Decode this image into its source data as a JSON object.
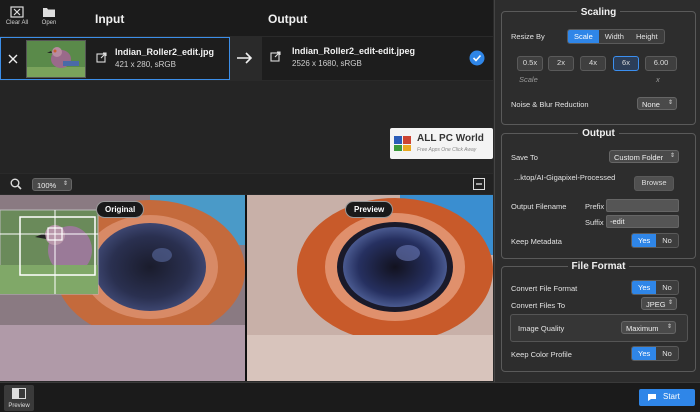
{
  "toolbar": {
    "clear_all": "Clear All",
    "open": "Open"
  },
  "headers": {
    "input": "Input",
    "output": "Output"
  },
  "input_file": {
    "name": "Indian_Roller2_edit.jpg",
    "meta": "421 x 280, sRGB"
  },
  "output_file": {
    "name": "Indian_Roller2_edit-edit.jpeg",
    "meta": "2526 x 1680, sRGB"
  },
  "watermark": {
    "title": "ALL PC World",
    "subtitle": "Free Apps One Click Away"
  },
  "zoom": {
    "value": "100%"
  },
  "preview": {
    "original_label": "Original",
    "preview_label": "Preview"
  },
  "bottom": {
    "preview_label": "Preview",
    "start_label": "Start"
  },
  "scaling": {
    "title": "Scaling",
    "resize_by_label": "Resize By",
    "resize_options": [
      "Scale",
      "Width",
      "Height"
    ],
    "scale_options": [
      "0.5x",
      "2x",
      "4x",
      "6x",
      "6.00"
    ],
    "scale_caption": "Scale",
    "scale_custom_caption": "x",
    "noise_label": "Noise & Blur Reduction",
    "noise_value": "None"
  },
  "output": {
    "title": "Output",
    "save_to_label": "Save To",
    "save_to_value": "Custom Folder",
    "path": "...ktop/AI-Gigapixel-Processed",
    "browse": "Browse",
    "filename_label": "Output Filename",
    "prefix_label": "Prefix",
    "suffix_label": "Suffix",
    "suffix_value": "-edit",
    "metadata_label": "Keep Metadata",
    "yes": "Yes",
    "no": "No"
  },
  "file_format": {
    "title": "File Format",
    "convert_label": "Convert File Format",
    "convert_to_label": "Convert Files To",
    "convert_to_value": "JPEG",
    "quality_label": "Image Quality",
    "quality_value": "Maximum",
    "color_profile_label": "Keep Color Profile",
    "yes": "Yes",
    "no": "No"
  },
  "colors": {
    "accent": "#2f86e8",
    "panel": "#2d2d2d",
    "dark": "#1b1b1b"
  },
  "icons": [
    "clear-all-icon",
    "open-folder-icon",
    "close-icon",
    "external-link-icon",
    "arrow-right-icon",
    "check-circle-icon",
    "search-icon",
    "collapse-icon",
    "start-icon"
  ]
}
